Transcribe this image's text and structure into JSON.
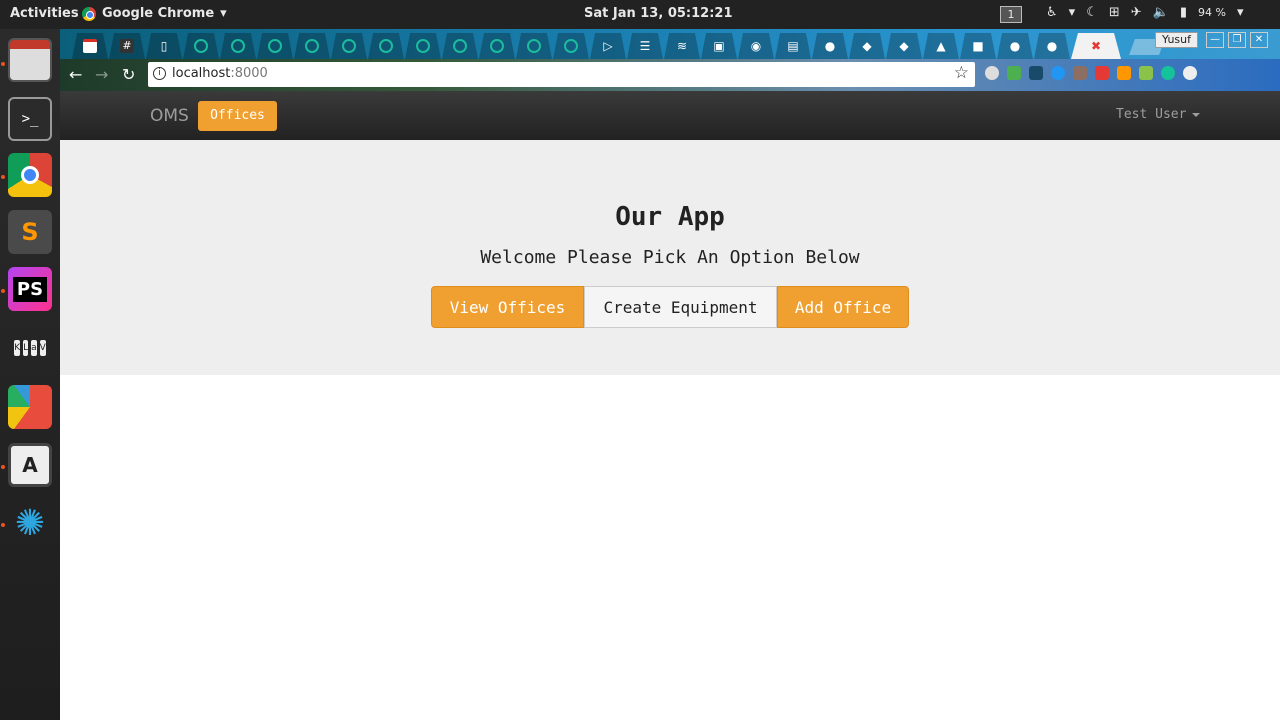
{
  "system_bar": {
    "activities": "Activities",
    "app_name": "Google Chrome",
    "clock": "Sat Jan 13, 05:12:21",
    "workspace": "1",
    "battery": "94 %"
  },
  "browser": {
    "window_user": "Yusuf",
    "url_host": "localhost",
    "url_port": ":8000"
  },
  "app": {
    "brand": "OMS",
    "nav_offices": "Offices",
    "user_menu": "Test User",
    "title": "Our App",
    "subtitle": "Welcome Please Pick An Option Below",
    "buttons": {
      "view_offices": "View Offices",
      "create_equipment": "Create Equipment",
      "add_office": "Add Office"
    }
  },
  "colors": {
    "accent": "#f0a030",
    "navbar": "#222222",
    "jumbotron": "#eeeeee"
  }
}
